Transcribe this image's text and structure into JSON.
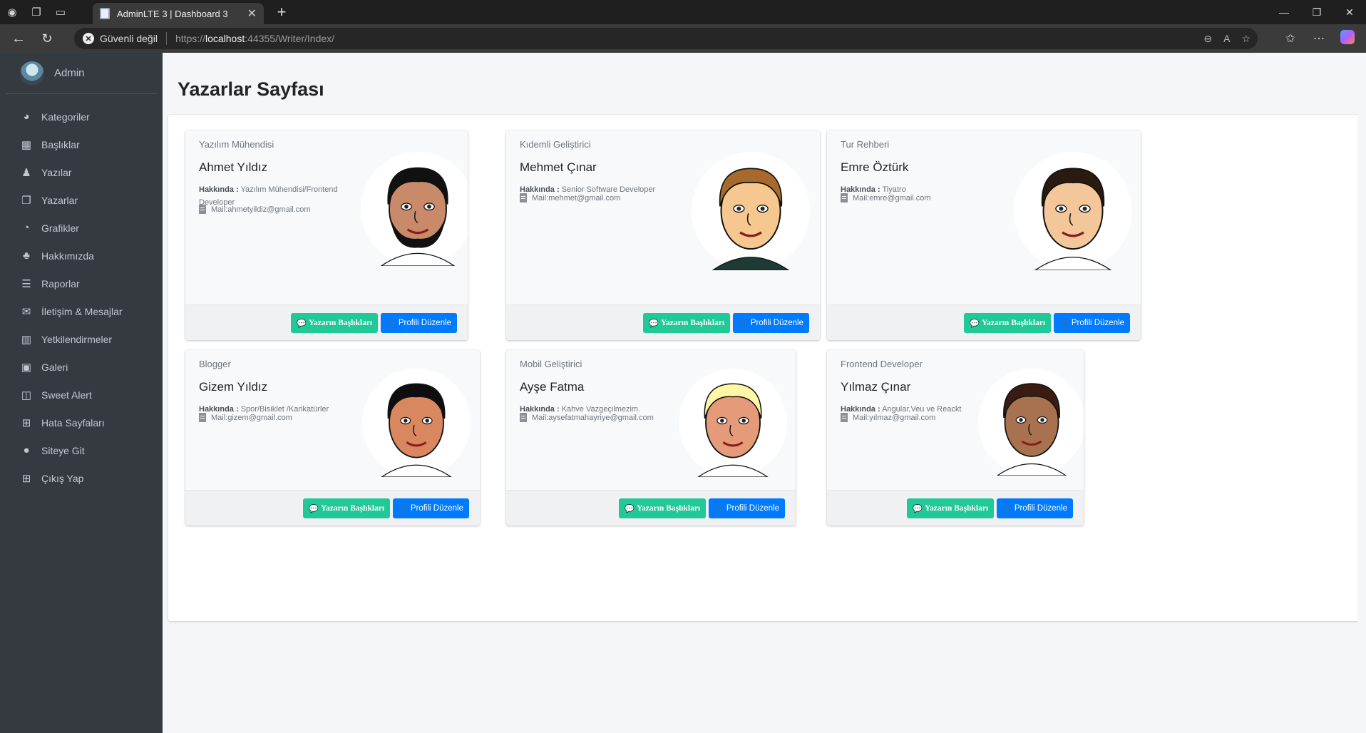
{
  "browser": {
    "tab_title": "AdminLTE 3 | Dashboard 3",
    "security_label": "Güvenli değil",
    "url_proto": "https://",
    "url_host": "localhost",
    "url_rest": ":44355/Writer/Index/"
  },
  "sidebar": {
    "user_name": "Admin",
    "items": [
      {
        "label": "Kategoriler",
        "icon": "tachometer-icon",
        "glyph": "◕"
      },
      {
        "label": "Başlıklar",
        "icon": "grid-icon",
        "glyph": "▦"
      },
      {
        "label": "Yazılar",
        "icon": "user-group-icon",
        "glyph": "♟"
      },
      {
        "label": "Yazarlar",
        "icon": "copy-icon",
        "glyph": "❐"
      },
      {
        "label": "Grafikler",
        "icon": "pie-chart-icon",
        "glyph": "◔"
      },
      {
        "label": "Hakkımızda",
        "icon": "tree-icon",
        "glyph": "♣"
      },
      {
        "label": "Raporlar",
        "icon": "list-icon",
        "glyph": "☰"
      },
      {
        "label": "İletişim & Mesajlar",
        "icon": "envelope-icon",
        "glyph": "✉"
      },
      {
        "label": "Yetkilendirmeler",
        "icon": "building-icon",
        "glyph": "▥"
      },
      {
        "label": "Galeri",
        "icon": "image-icon",
        "glyph": "▣"
      },
      {
        "label": "Sweet Alert",
        "icon": "map-icon",
        "glyph": "◫"
      },
      {
        "label": "Hata Sayfaları",
        "icon": "table-icon",
        "glyph": "⊞"
      },
      {
        "label": "Siteye Git",
        "icon": "apple-icon",
        "glyph": "●"
      },
      {
        "label": "Çıkış Yap",
        "icon": "plus-square-icon",
        "glyph": "⊞"
      }
    ]
  },
  "page": {
    "title": "Yazarlar Sayfası"
  },
  "labels": {
    "about_prefix": "Hakkında :",
    "mail_prefix": "Mail: ",
    "btn_titles": "Yazarın Başlıkları",
    "btn_profile": "Profili Düzenle"
  },
  "writers": [
    {
      "role": "Yazılım Mühendisi",
      "name": "Ahmet Yıldız",
      "about": "Yazılım Mühendisi/Frontend Developer",
      "mail": "ahmetyildiz@gmail.com"
    },
    {
      "role": "Kıdemli Geliştirici",
      "name": "Mehmet Çınar",
      "about": "Senior Software Developer",
      "mail": "mehmet@gmail.com"
    },
    {
      "role": "Tur Rehberi",
      "name": "Emre Öztürk",
      "about": "Tiyatro",
      "mail": "emre@gmail.com"
    },
    {
      "role": "Blogger",
      "name": "Gizem Yıldız",
      "about": "Spor/Bisiklet /Karikatürler",
      "mail": "gizem@gmail.com"
    },
    {
      "role": "Mobil Geliştirici",
      "name": "Ayşe Fatma",
      "about": "Kahve Vazgeçilmezim.",
      "mail": "aysefatmahayriye@gmail.com"
    },
    {
      "role": "Frontend Developer",
      "name": "Yılmaz Çınar",
      "about": "Angular,Veu ve Reackt",
      "mail": "yılmaz@gmail.com"
    }
  ]
}
